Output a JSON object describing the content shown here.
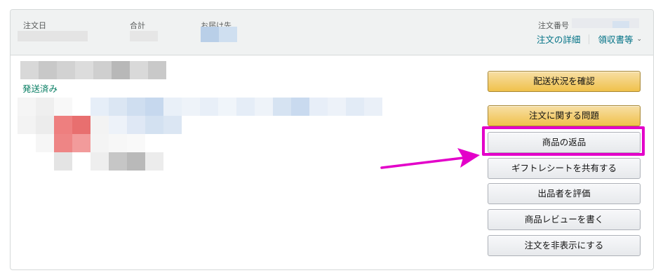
{
  "order_header": {
    "order_date_label": "注文日",
    "total_label": "合計",
    "ship_to_label": "お届け先",
    "order_number_label": "注文番号",
    "order_details_link": "注文の詳細",
    "receipt_link": "領収書等",
    "receipt_chevron": "⌄"
  },
  "shipment": {
    "status": "発送済み"
  },
  "actions": [
    {
      "label": "配送状況を確認",
      "style": "primary"
    },
    {
      "label": "注文に関する問題",
      "style": "primary"
    },
    {
      "label": "商品の返品",
      "style": "secondary",
      "highlighted": true
    },
    {
      "label": "ギフトレシートを共有する",
      "style": "secondary"
    },
    {
      "label": "出品者を評価",
      "style": "secondary"
    },
    {
      "label": "商品レビューを書く",
      "style": "secondary"
    },
    {
      "label": "注文を非表示にする",
      "style": "secondary"
    }
  ],
  "annotation": {
    "highlight_color": "#e300c9",
    "arrow_color": "#e300c9"
  },
  "colors": {
    "link": "#007185",
    "status_green": "#067d62",
    "primary_button": "#f0c14b"
  }
}
